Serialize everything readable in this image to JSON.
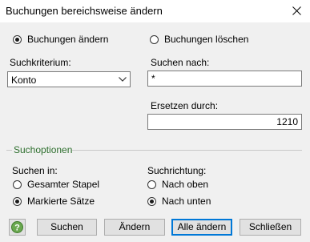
{
  "window": {
    "title": "Buchungen bereichsweise ändern"
  },
  "mode": {
    "change_label": "Buchungen ändern",
    "change_checked": true,
    "delete_label": "Buchungen löschen",
    "delete_checked": false
  },
  "search": {
    "criterion_label": "Suchkriterium:",
    "criterion_value": "Konto",
    "search_for_label": "Suchen nach:",
    "search_for_value": "*",
    "replace_label": "Ersetzen durch:",
    "replace_value": "1210"
  },
  "options": {
    "group_title": "Suchoptionen",
    "search_in_label": "Suchen in:",
    "search_in_all_label": "Gesamter Stapel",
    "search_in_all_checked": false,
    "search_in_marked_label": "Markierte Sätze",
    "search_in_marked_checked": true,
    "direction_label": "Suchrichtung:",
    "direction_up_label": "Nach oben",
    "direction_up_checked": false,
    "direction_down_label": "Nach unten",
    "direction_down_checked": true
  },
  "buttons": {
    "search": "Suchen",
    "change": "Ändern",
    "change_all": "Alle ändern",
    "close": "Schließen"
  },
  "colors": {
    "group_title": "#2e6f2e",
    "default_button_border": "#0078d7",
    "help_icon": "#6aa84f"
  }
}
